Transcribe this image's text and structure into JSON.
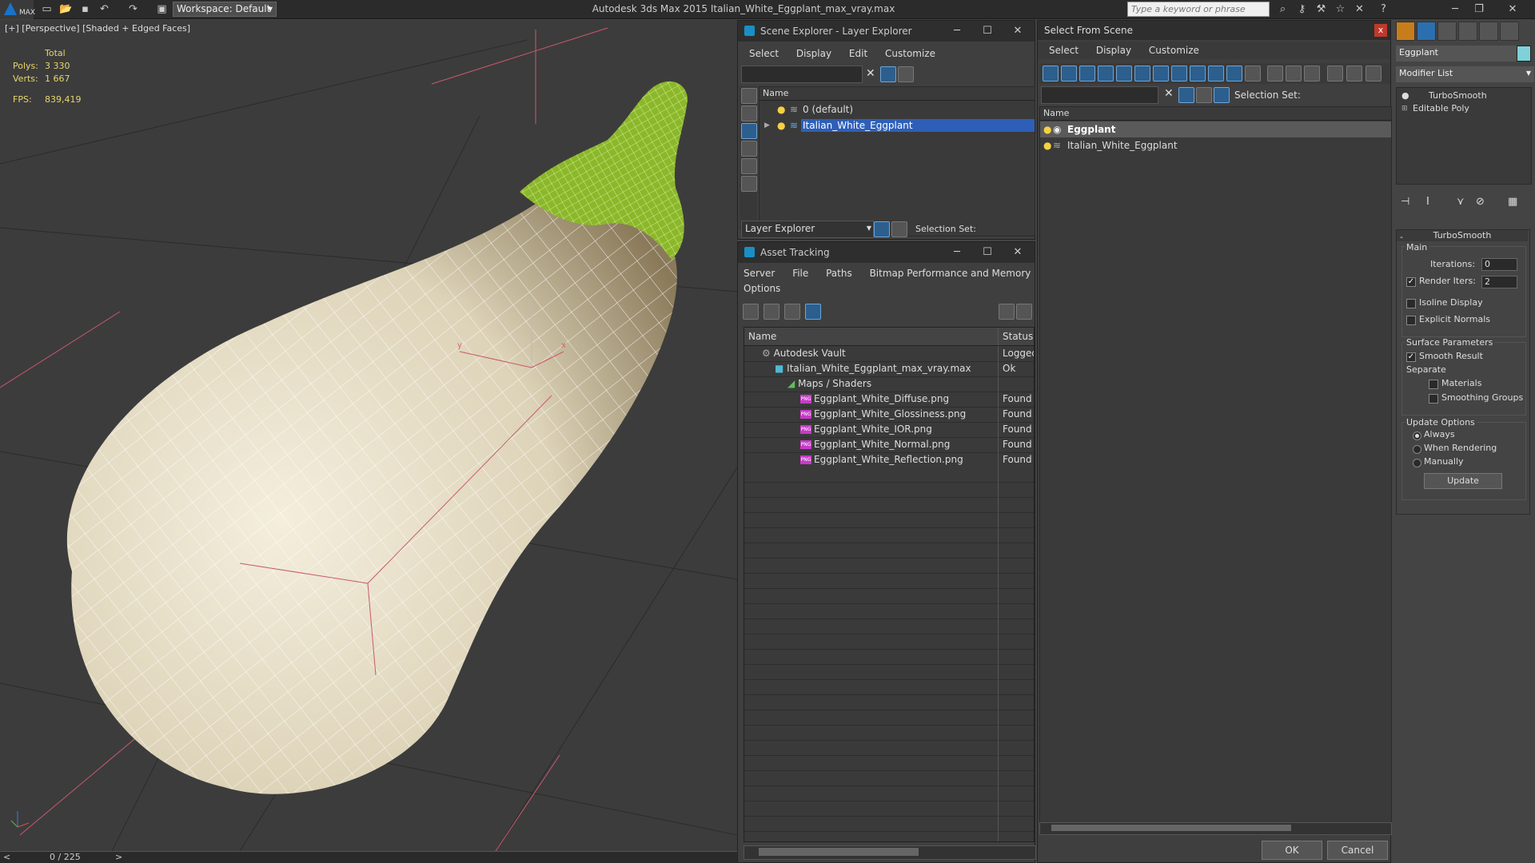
{
  "topbar": {
    "logo": "MAX",
    "workspace": "Workspace: Default",
    "title": "Autodesk 3ds Max  2015     Italian_White_Eggplant_max_vray.max",
    "search_placeholder": "Type a keyword or phrase"
  },
  "viewport": {
    "label": "[+] [Perspective] [Shaded + Edged Faces]",
    "stats": {
      "total_label": "Total",
      "polys_label": "Polys:",
      "polys_value": "3 330",
      "verts_label": "Verts:",
      "verts_value": "1 667",
      "fps_label": "FPS:",
      "fps_value": "839,419"
    },
    "gizmo": {
      "x": "x",
      "y": "y",
      "z": "z"
    }
  },
  "timeline": {
    "frame": "0 / 225",
    "prev": "<",
    "next": ">"
  },
  "scene_explorer": {
    "title": "Scene Explorer - Layer Explorer",
    "menu": [
      "Select",
      "Display",
      "Edit",
      "Customize"
    ],
    "column_name": "Name",
    "rows": [
      "0 (default)",
      "Italian_White_Eggplant"
    ],
    "bottom_dropdown": "Layer Explorer",
    "selection_set": "Selection Set:"
  },
  "asset_tracking": {
    "title": "Asset Tracking",
    "menu": [
      "Server",
      "File",
      "Paths",
      "Bitmap Performance and Memory"
    ],
    "menu2": "Options",
    "col_name": "Name",
    "col_status": "Status",
    "rows": [
      {
        "name": "Autodesk Vault",
        "status": "Logged"
      },
      {
        "name": "Italian_White_Eggplant_max_vray.max",
        "status": "Ok"
      },
      {
        "name": "Maps / Shaders",
        "status": ""
      },
      {
        "name": "Eggplant_White_Diffuse.png",
        "status": "Found"
      },
      {
        "name": "Eggplant_White_Glossiness.png",
        "status": "Found"
      },
      {
        "name": "Eggplant_White_IOR.png",
        "status": "Found"
      },
      {
        "name": "Eggplant_White_Normal.png",
        "status": "Found"
      },
      {
        "name": "Eggplant_White_Reflection.png",
        "status": "Found"
      }
    ],
    "png_badge": "PNG"
  },
  "select_from_scene": {
    "title": "Select From Scene",
    "close": "x",
    "menu": [
      "Select",
      "Display",
      "Customize"
    ],
    "selection_set": "Selection Set:",
    "column_name": "Name",
    "rows": [
      "Eggplant",
      "Italian_White_Eggplant"
    ],
    "ok": "OK",
    "cancel": "Cancel"
  },
  "command_panel": {
    "object_name": "Eggplant",
    "modifier_list": "Modifier List",
    "stack": [
      "TurboSmooth",
      "Editable Poly"
    ],
    "rollout_title": "TurboSmooth",
    "main_group": "Main",
    "iterations_label": "Iterations:",
    "iterations_value": "0",
    "render_iters_label": "Render Iters:",
    "render_iters_value": "2",
    "render_iters_checked": true,
    "isoline_label": "Isoline Display",
    "explicit_normals_label": "Explicit Normals",
    "surface_group": "Surface Parameters",
    "smooth_result_label": "Smooth Result",
    "smooth_result_checked": true,
    "separate_label": "Separate",
    "materials_label": "Materials",
    "smoothing_groups_label": "Smoothing Groups",
    "update_group": "Update Options",
    "always_label": "Always",
    "when_rendering_label": "When Rendering",
    "manually_label": "Manually",
    "update_button": "Update",
    "color_swatch": "#7fd1d9"
  }
}
